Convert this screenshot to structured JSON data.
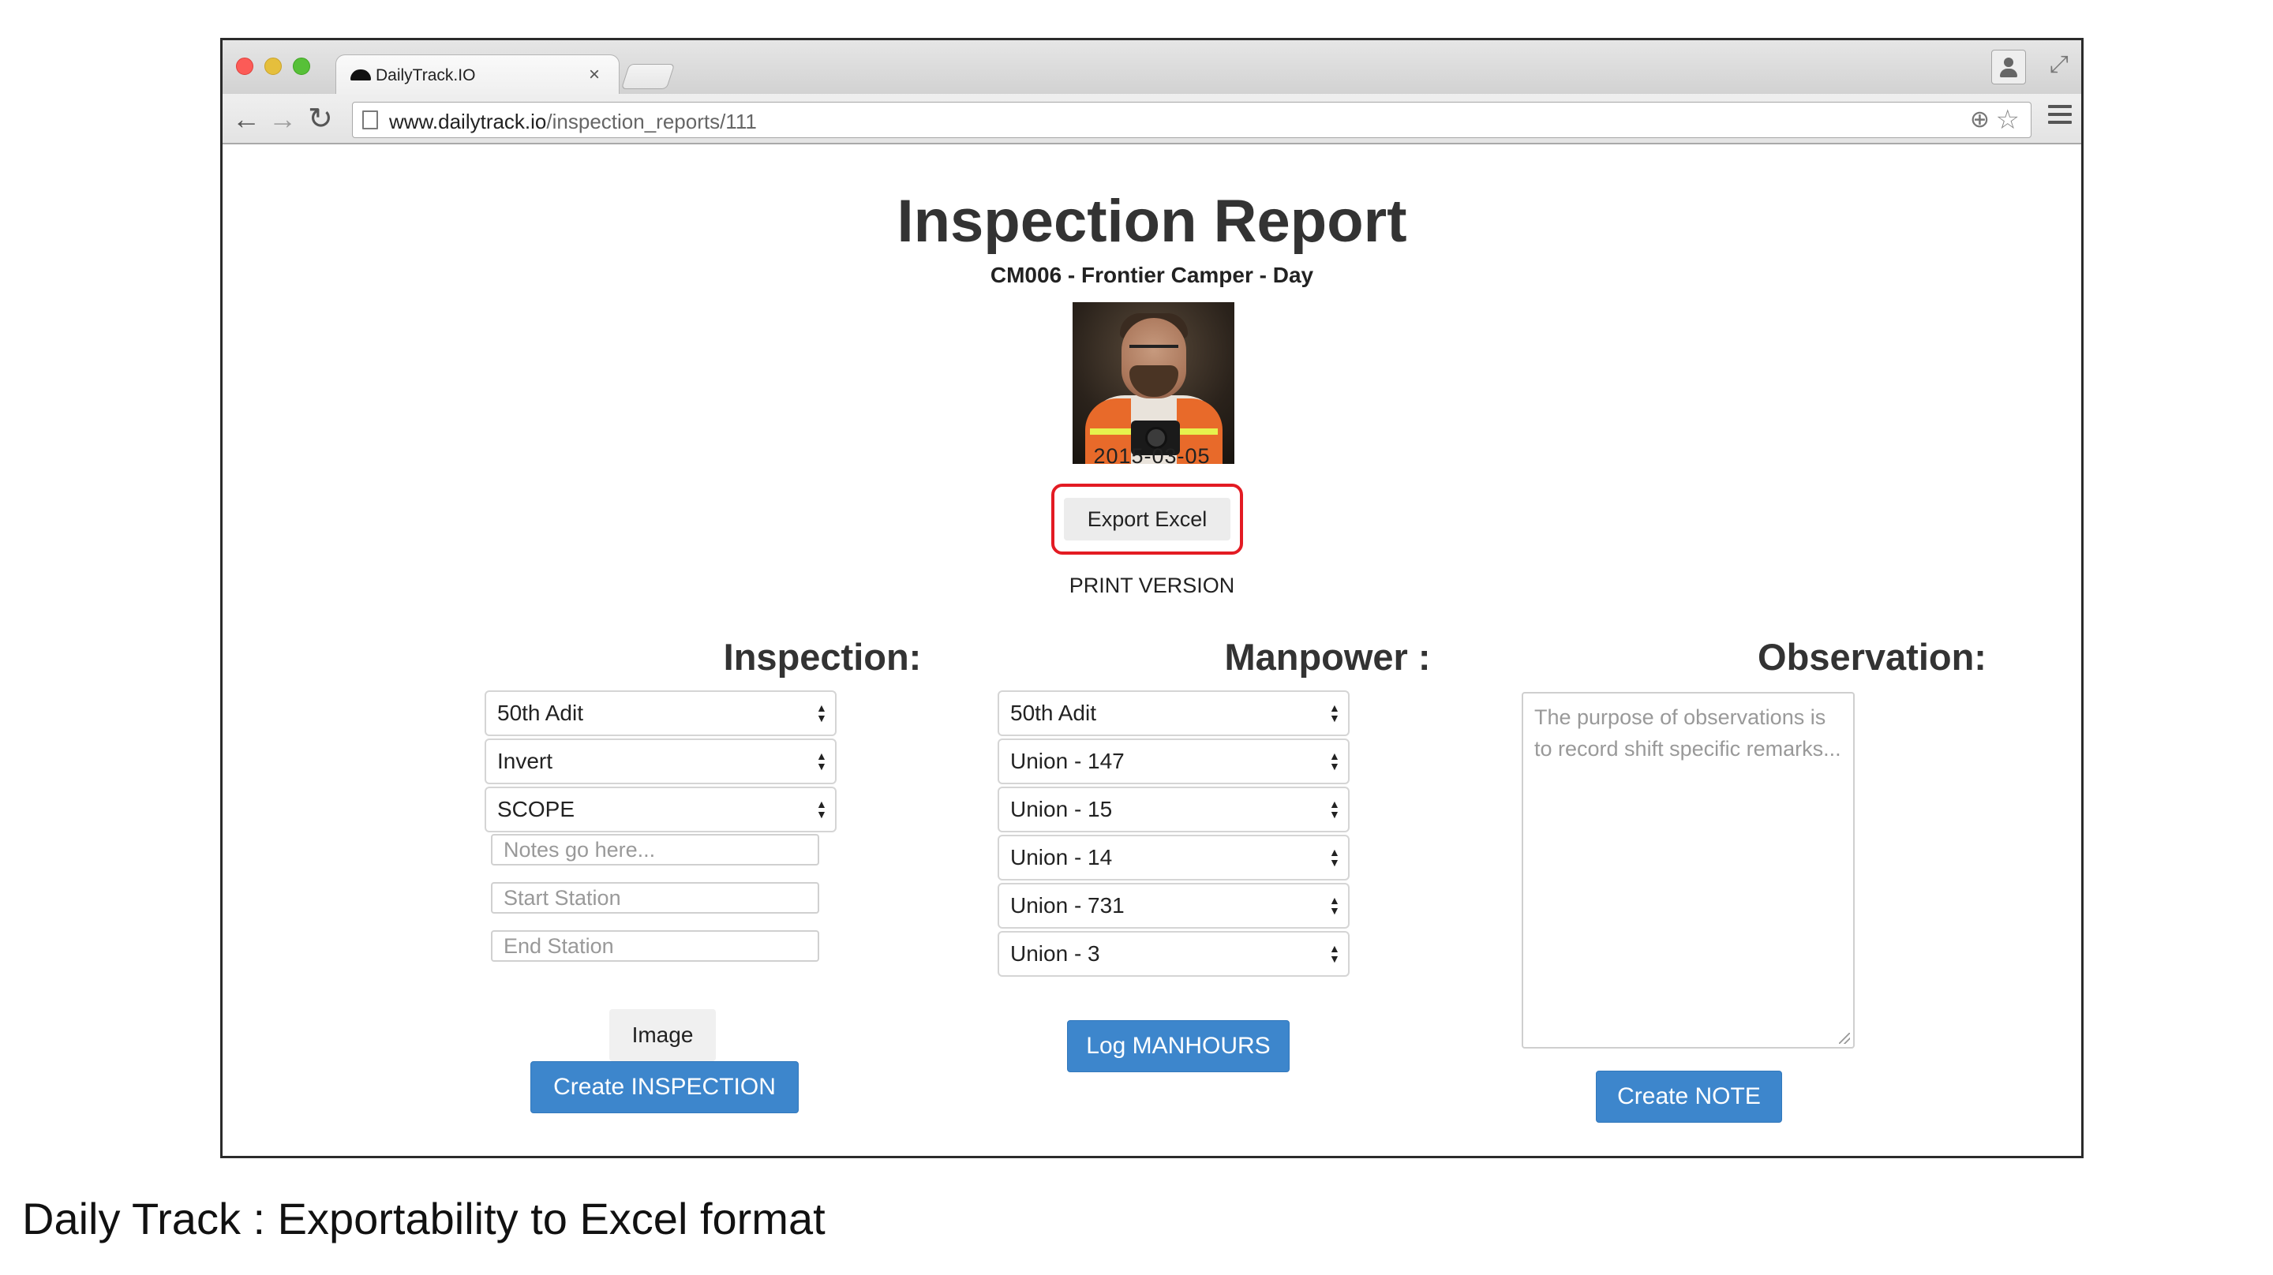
{
  "browser": {
    "tab_title": "DailyTrack.IO",
    "tab_close": "×",
    "url_domain": "www.dailytrack.io",
    "url_path": "/inspection_reports/111"
  },
  "report": {
    "title": "Inspection Report",
    "subtitle": "CM006 - Frontier Camper - Day",
    "date": "2015-03-05",
    "export_label": "Export Excel",
    "print_label": "PRINT VERSION",
    "highlight_color": "#e31b23"
  },
  "inspection": {
    "heading": "Inspection:",
    "selects": [
      "50th Adit",
      "Invert",
      "SCOPE"
    ],
    "notes_placeholder": "Notes go here...",
    "start_placeholder": "Start Station",
    "end_placeholder": "End Station",
    "image_label": "Image",
    "create_label": "Create INSPECTION"
  },
  "manpower": {
    "heading": "Manpower :",
    "selects": [
      "50th Adit",
      "Union - 147",
      "Union - 15",
      "Union - 14",
      "Union - 731",
      "Union - 3"
    ],
    "log_label": "Log MANHOURS"
  },
  "observation": {
    "heading": "Observation:",
    "placeholder": "The purpose of observations is to record shift specific remarks...",
    "create_label": "Create NOTE"
  },
  "caption": "Daily Track : Exportability to Excel format",
  "colors": {
    "primary_button": "#3d86cc"
  },
  "icons": [
    "back-arrow-icon",
    "forward-arrow-icon",
    "reload-icon",
    "page-icon",
    "zoom-icon",
    "star-icon",
    "menu-icon",
    "profile-icon",
    "fullscreen-icon"
  ]
}
